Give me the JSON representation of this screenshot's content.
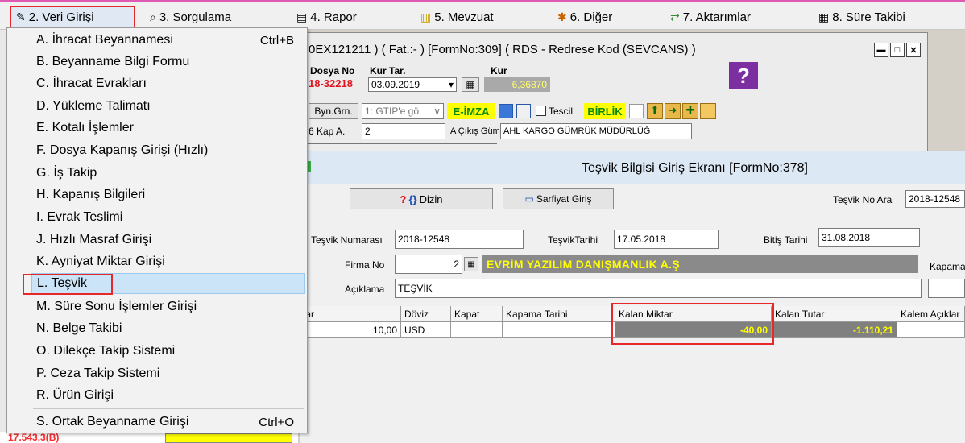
{
  "menubar": {
    "items": [
      {
        "label": "2.  Veri Girişi",
        "icon": "pencil-icon"
      },
      {
        "label": "3.  Sorgulama",
        "icon": "magnifier-icon"
      },
      {
        "label": "4.  Rapor",
        "icon": "printer-icon"
      },
      {
        "label": "5.  Mevzuat",
        "icon": "books-icon"
      },
      {
        "label": "6.  Diğer",
        "icon": "tools-icon"
      },
      {
        "label": "7.  Aktarımlar",
        "icon": "transfer-icon"
      },
      {
        "label": "8. Süre Takibi",
        "icon": "calendar-icon"
      }
    ]
  },
  "dropdown": {
    "items": [
      {
        "label": "A.  İhracat Beyannamesi",
        "shortcut": "Ctrl+B"
      },
      {
        "label": "B.  Beyanname Bilgi Formu",
        "shortcut": ""
      },
      {
        "label": "C.  İhracat Evrakları",
        "shortcut": ""
      },
      {
        "label": "D.  Yükleme Talimatı",
        "shortcut": ""
      },
      {
        "label": "E.  Kotalı İşlemler",
        "shortcut": ""
      },
      {
        "label": "F.  Dosya Kapanış Girişi (Hızlı)",
        "shortcut": ""
      },
      {
        "label": "G.  İş Takip",
        "shortcut": ""
      },
      {
        "label": "H.  Kapanış Bilgileri",
        "shortcut": ""
      },
      {
        "label": "I.  Evrak Teslimi",
        "shortcut": ""
      },
      {
        "label": "J.  Hızlı Masraf Girişi",
        "shortcut": ""
      },
      {
        "label": "K.  Ayniyat Miktar Girişi",
        "shortcut": ""
      },
      {
        "label": "L.  Teşvik",
        "shortcut": ""
      },
      {
        "label": "M.  Süre Sonu İşlemler Girişi",
        "shortcut": ""
      },
      {
        "label": "N.  Belge Takibi",
        "shortcut": ""
      },
      {
        "label": "O.  Dilekçe Takip Sistemi",
        "shortcut": ""
      },
      {
        "label": "P.  Ceza Takip Sistemi",
        "shortcut": ""
      },
      {
        "label": "R.  Ürün Girişi",
        "shortcut": ""
      },
      {
        "label": "S.  Ortak Beyanname Girişi",
        "shortcut": "Ctrl+O"
      }
    ],
    "selected_index": 11
  },
  "backwin": {
    "title": "0EX121211 ) ( Fat.:- )  [FormNo:309] ( RDS - Redrese Kod (SEVCANS) )",
    "dosya_no_label": "Dosya No",
    "dosya_no": "18-32218",
    "kur_tar_label": "Kur Tar.",
    "kur_tar": "03.09.2019",
    "kur_label": "Kur",
    "kur": "6,36870",
    "byn_grn": "Byn.Grn.",
    "gtip_select": "1: GTIP'e gö",
    "eimza": "E-İMZA",
    "tescil": "Tescil",
    "birlik": "BİRLİK",
    "kap_a_label": "6 Kap A.",
    "kap_a_value": "2",
    "cikis_gum_label": "A Çıkış Güm.",
    "cikis_gum_value": "AHL KARGO GÜMRÜK MÜDÜRLÜĞ"
  },
  "frontwin": {
    "title": "Teşvik Bilgisi Giriş Ekranı [FormNo:378]",
    "dizin_label": "Dizin",
    "sarfiyat_label": "Sarfiyat Giriş",
    "tesvik_no_ara_label": "Teşvik No Ara",
    "tesvik_no_ara_value": "2018-12548",
    "tesvik_numarasi_label": "Teşvik Numarası",
    "tesvik_numarasi": "2018-12548",
    "tesvik_tarihi_label": "TeşvikTarihi",
    "tesvik_tarihi": "17.05.2018",
    "bitis_tarihi_label": "Bitiş Tarihi",
    "bitis_tarihi": "31.08.2018",
    "firma_no_label": "Firma No",
    "firma_no": "2",
    "firma_name": "EVRİM YAZILIM DANIŞMANLIK A.Ş",
    "kapama_label": "Kapama",
    "aciklama_label": "Açıklama",
    "aciklama": "TEŞVİK",
    "grid": {
      "headers": [
        "tar",
        "Döviz",
        "Kapat",
        "Kapama Tarihi",
        "Kalan Miktar",
        "Kalan Tutar",
        "Kalem Açıklar"
      ],
      "row": {
        "tutar": "10,00",
        "doviz": "USD",
        "kapat": "",
        "kapama_tarihi": "",
        "kalan_miktar": "-40,00",
        "kalan_tutar": "-1.110,21",
        "kalem_aciklama": ""
      }
    }
  },
  "bottom": {
    "value": "17.543,3(B)"
  },
  "colors": {
    "highlight": "#e8272b",
    "firm_bar": "#8a8a8a",
    "firm_text": "#ffff00",
    "kur_bg": "#a9a9a9",
    "eimza_bg": "#ffff00",
    "birlik_bg": "#ffff00"
  }
}
